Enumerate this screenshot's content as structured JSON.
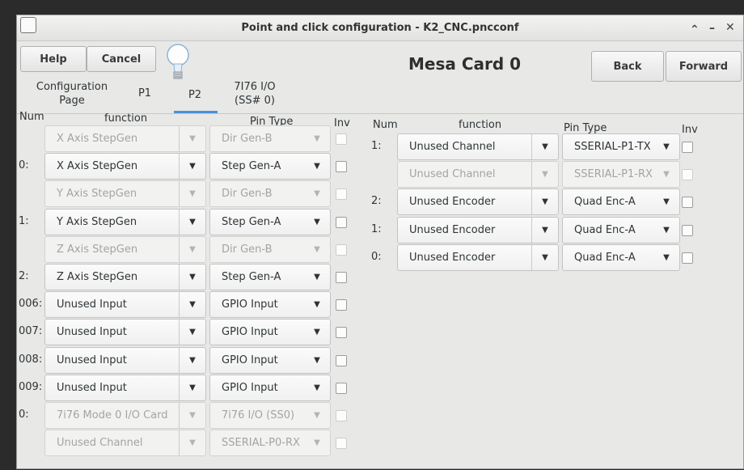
{
  "window": {
    "title": "Point and click configuration - K2_CNC.pncconf"
  },
  "toolbar": {
    "help_label": "Help",
    "cancel_label": "Cancel",
    "card_title": "Mesa Card 0",
    "back_label": "Back",
    "forward_label": "Forward"
  },
  "tabs": [
    {
      "label_line1": "Configuration",
      "label_line2": "Page"
    },
    {
      "label_line1": "P1",
      "label_line2": ""
    },
    {
      "label_line1": "P2",
      "label_line2": ""
    },
    {
      "label_line1": "7I76 I/O",
      "label_line2": "(SS# 0)"
    }
  ],
  "left_table": {
    "headers": {
      "num": "Num",
      "function": "function",
      "pin_type": "Pin Type",
      "inv": "Inv"
    },
    "rows": [
      {
        "num": "",
        "function": "X Axis StepGen",
        "pin_type": "Dir Gen-B",
        "enabled": false
      },
      {
        "num": "0:",
        "function": "X Axis StepGen",
        "pin_type": "Step Gen-A",
        "enabled": true
      },
      {
        "num": "",
        "function": "Y Axis StepGen",
        "pin_type": "Dir Gen-B",
        "enabled": false
      },
      {
        "num": "1:",
        "function": "Y Axis StepGen",
        "pin_type": "Step Gen-A",
        "enabled": true
      },
      {
        "num": "",
        "function": "Z Axis StepGen",
        "pin_type": "Dir Gen-B",
        "enabled": false
      },
      {
        "num": "2:",
        "function": "Z Axis StepGen",
        "pin_type": "Step Gen-A",
        "enabled": true
      },
      {
        "num": "006:",
        "function": "Unused Input",
        "pin_type": "GPIO Input",
        "enabled": true
      },
      {
        "num": "007:",
        "function": "Unused Input",
        "pin_type": "GPIO Input",
        "enabled": true
      },
      {
        "num": "008:",
        "function": "Unused Input",
        "pin_type": "GPIO Input",
        "enabled": true
      },
      {
        "num": "009:",
        "function": "Unused Input",
        "pin_type": "GPIO Input",
        "enabled": true
      },
      {
        "num": "0:",
        "function": "7i76 Mode 0 I/O Card",
        "pin_type": "7i76 I/O (SS0)",
        "enabled": false
      },
      {
        "num": "",
        "function": "Unused Channel",
        "pin_type": "SSERIAL-P0-RX",
        "enabled": false
      }
    ]
  },
  "right_table": {
    "headers": {
      "num": "Num",
      "function": "function",
      "pin_type": "Pin Type",
      "inv": "Inv"
    },
    "rows": [
      {
        "num": "1:",
        "function": "Unused Channel",
        "pin_type": "SSERIAL-P1-TX",
        "enabled": true
      },
      {
        "num": "",
        "function": "Unused Channel",
        "pin_type": "SSERIAL-P1-RX",
        "enabled": false
      },
      {
        "num": "2:",
        "function": "Unused Encoder",
        "pin_type": "Quad Enc-A",
        "enabled": true
      },
      {
        "num": "1:",
        "function": "Unused Encoder",
        "pin_type": "Quad Enc-A",
        "enabled": true
      },
      {
        "num": "0:",
        "function": "Unused Encoder",
        "pin_type": "Quad Enc-A",
        "enabled": true
      }
    ]
  }
}
